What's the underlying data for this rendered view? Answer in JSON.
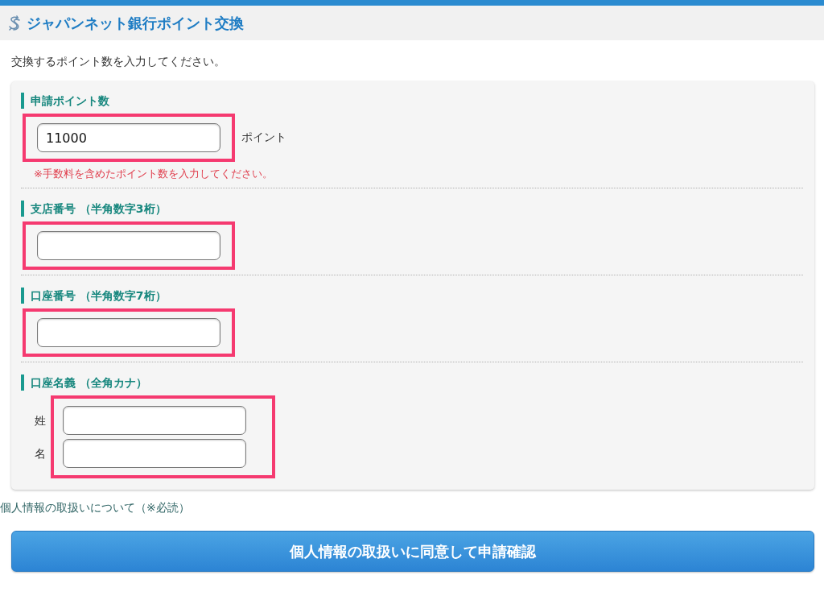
{
  "header": {
    "title": "ジャパンネット銀行ポイント交換"
  },
  "instruction": "交換するポイント数を入力してください。",
  "form": {
    "sections": [
      {
        "label": "申請ポイント数",
        "highlighted": true,
        "fields": [
          {
            "kind": "text",
            "value": "11000",
            "unit": "ポイント"
          }
        ],
        "note": "※手数料を含めたポイント数を入力してください。"
      },
      {
        "label": "支店番号 （半角数字3桁）",
        "highlighted": true,
        "fields": [
          {
            "kind": "text"
          }
        ]
      },
      {
        "label": "口座番号 （半角数字7桁）",
        "highlighted": true,
        "fields": [
          {
            "kind": "text"
          }
        ]
      },
      {
        "label": "口座名義 （全角カナ）",
        "highlighted": true,
        "fields": [
          {
            "kind": "text",
            "label": "姓"
          },
          {
            "kind": "text",
            "label": "名"
          }
        ]
      }
    ]
  },
  "privacy_link": "個人情報の取扱いについて（※必読）",
  "submit_button": "個人情報の取扱いに同意して申請確認"
}
